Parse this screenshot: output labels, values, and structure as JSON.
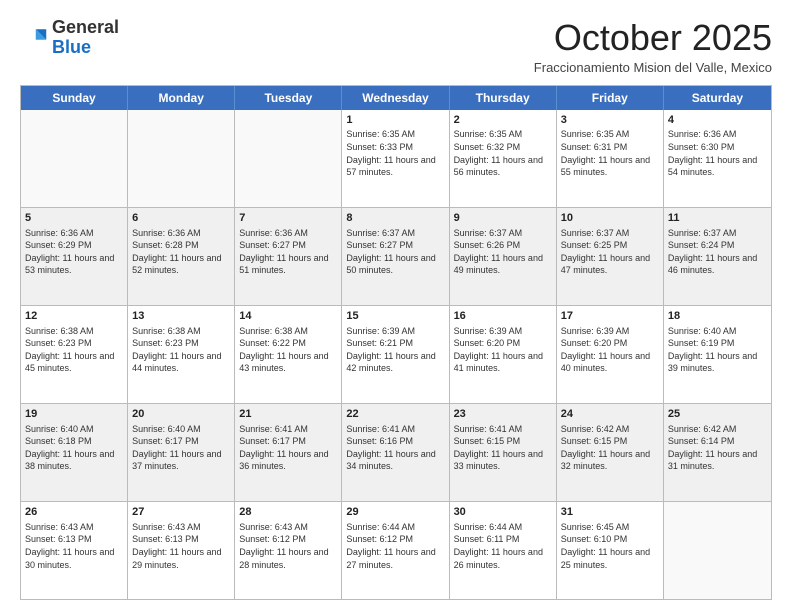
{
  "logo": {
    "general": "General",
    "blue": "Blue"
  },
  "header": {
    "month": "October 2025",
    "location": "Fraccionamiento Mision del Valle, Mexico"
  },
  "days": [
    "Sunday",
    "Monday",
    "Tuesday",
    "Wednesday",
    "Thursday",
    "Friday",
    "Saturday"
  ],
  "rows": [
    [
      {
        "day": "",
        "info": ""
      },
      {
        "day": "",
        "info": ""
      },
      {
        "day": "",
        "info": ""
      },
      {
        "day": "1",
        "info": "Sunrise: 6:35 AM\nSunset: 6:33 PM\nDaylight: 11 hours and 57 minutes."
      },
      {
        "day": "2",
        "info": "Sunrise: 6:35 AM\nSunset: 6:32 PM\nDaylight: 11 hours and 56 minutes."
      },
      {
        "day": "3",
        "info": "Sunrise: 6:35 AM\nSunset: 6:31 PM\nDaylight: 11 hours and 55 minutes."
      },
      {
        "day": "4",
        "info": "Sunrise: 6:36 AM\nSunset: 6:30 PM\nDaylight: 11 hours and 54 minutes."
      }
    ],
    [
      {
        "day": "5",
        "info": "Sunrise: 6:36 AM\nSunset: 6:29 PM\nDaylight: 11 hours and 53 minutes."
      },
      {
        "day": "6",
        "info": "Sunrise: 6:36 AM\nSunset: 6:28 PM\nDaylight: 11 hours and 52 minutes."
      },
      {
        "day": "7",
        "info": "Sunrise: 6:36 AM\nSunset: 6:27 PM\nDaylight: 11 hours and 51 minutes."
      },
      {
        "day": "8",
        "info": "Sunrise: 6:37 AM\nSunset: 6:27 PM\nDaylight: 11 hours and 50 minutes."
      },
      {
        "day": "9",
        "info": "Sunrise: 6:37 AM\nSunset: 6:26 PM\nDaylight: 11 hours and 49 minutes."
      },
      {
        "day": "10",
        "info": "Sunrise: 6:37 AM\nSunset: 6:25 PM\nDaylight: 11 hours and 47 minutes."
      },
      {
        "day": "11",
        "info": "Sunrise: 6:37 AM\nSunset: 6:24 PM\nDaylight: 11 hours and 46 minutes."
      }
    ],
    [
      {
        "day": "12",
        "info": "Sunrise: 6:38 AM\nSunset: 6:23 PM\nDaylight: 11 hours and 45 minutes."
      },
      {
        "day": "13",
        "info": "Sunrise: 6:38 AM\nSunset: 6:23 PM\nDaylight: 11 hours and 44 minutes."
      },
      {
        "day": "14",
        "info": "Sunrise: 6:38 AM\nSunset: 6:22 PM\nDaylight: 11 hours and 43 minutes."
      },
      {
        "day": "15",
        "info": "Sunrise: 6:39 AM\nSunset: 6:21 PM\nDaylight: 11 hours and 42 minutes."
      },
      {
        "day": "16",
        "info": "Sunrise: 6:39 AM\nSunset: 6:20 PM\nDaylight: 11 hours and 41 minutes."
      },
      {
        "day": "17",
        "info": "Sunrise: 6:39 AM\nSunset: 6:20 PM\nDaylight: 11 hours and 40 minutes."
      },
      {
        "day": "18",
        "info": "Sunrise: 6:40 AM\nSunset: 6:19 PM\nDaylight: 11 hours and 39 minutes."
      }
    ],
    [
      {
        "day": "19",
        "info": "Sunrise: 6:40 AM\nSunset: 6:18 PM\nDaylight: 11 hours and 38 minutes."
      },
      {
        "day": "20",
        "info": "Sunrise: 6:40 AM\nSunset: 6:17 PM\nDaylight: 11 hours and 37 minutes."
      },
      {
        "day": "21",
        "info": "Sunrise: 6:41 AM\nSunset: 6:17 PM\nDaylight: 11 hours and 36 minutes."
      },
      {
        "day": "22",
        "info": "Sunrise: 6:41 AM\nSunset: 6:16 PM\nDaylight: 11 hours and 34 minutes."
      },
      {
        "day": "23",
        "info": "Sunrise: 6:41 AM\nSunset: 6:15 PM\nDaylight: 11 hours and 33 minutes."
      },
      {
        "day": "24",
        "info": "Sunrise: 6:42 AM\nSunset: 6:15 PM\nDaylight: 11 hours and 32 minutes."
      },
      {
        "day": "25",
        "info": "Sunrise: 6:42 AM\nSunset: 6:14 PM\nDaylight: 11 hours and 31 minutes."
      }
    ],
    [
      {
        "day": "26",
        "info": "Sunrise: 6:43 AM\nSunset: 6:13 PM\nDaylight: 11 hours and 30 minutes."
      },
      {
        "day": "27",
        "info": "Sunrise: 6:43 AM\nSunset: 6:13 PM\nDaylight: 11 hours and 29 minutes."
      },
      {
        "day": "28",
        "info": "Sunrise: 6:43 AM\nSunset: 6:12 PM\nDaylight: 11 hours and 28 minutes."
      },
      {
        "day": "29",
        "info": "Sunrise: 6:44 AM\nSunset: 6:12 PM\nDaylight: 11 hours and 27 minutes."
      },
      {
        "day": "30",
        "info": "Sunrise: 6:44 AM\nSunset: 6:11 PM\nDaylight: 11 hours and 26 minutes."
      },
      {
        "day": "31",
        "info": "Sunrise: 6:45 AM\nSunset: 6:10 PM\nDaylight: 11 hours and 25 minutes."
      },
      {
        "day": "",
        "info": ""
      }
    ]
  ]
}
